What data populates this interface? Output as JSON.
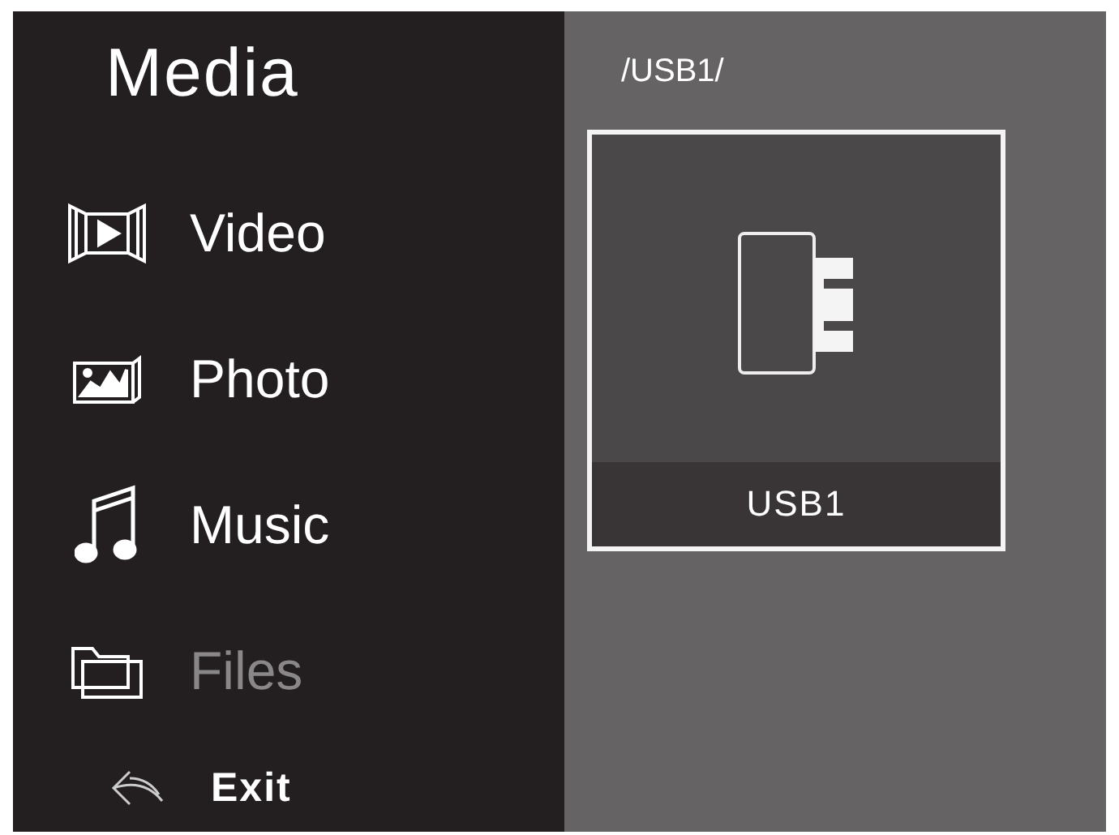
{
  "sidebar": {
    "title": "Media",
    "items": [
      {
        "kind": "video",
        "label": "Video",
        "selected": false
      },
      {
        "kind": "photo",
        "label": "Photo",
        "selected": false
      },
      {
        "kind": "music",
        "label": "Music",
        "selected": false
      },
      {
        "kind": "folder",
        "label": "Files",
        "selected": true
      }
    ],
    "exit": "Exit"
  },
  "browser": {
    "path": "/USB1/",
    "tiles": [
      {
        "kind": "usb",
        "label": "USB1",
        "selected": true
      }
    ]
  }
}
